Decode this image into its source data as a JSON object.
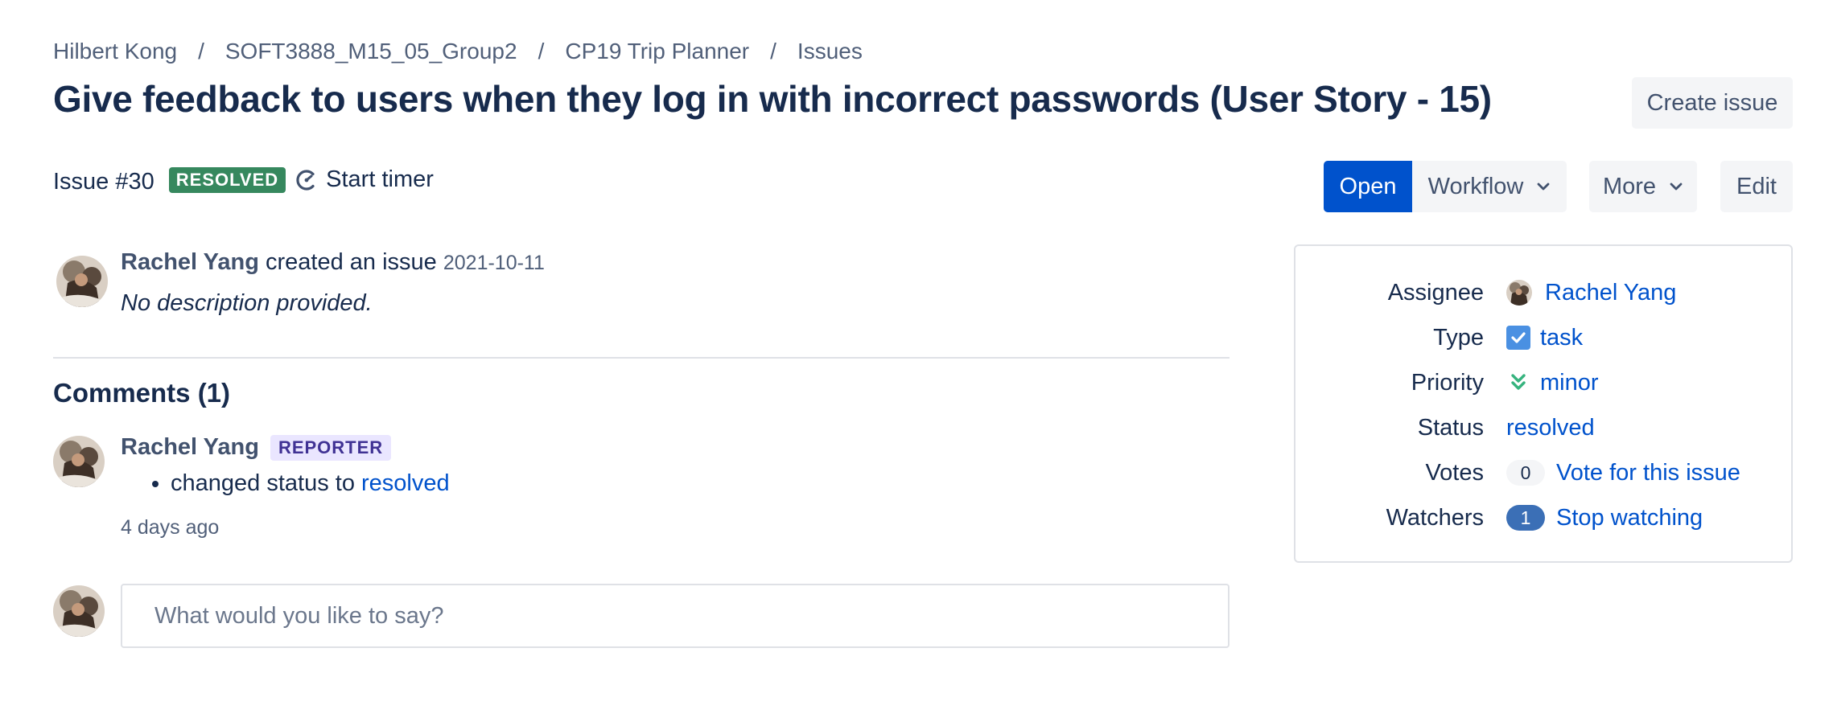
{
  "breadcrumb": [
    "Hilbert Kong",
    "SOFT3888_M15_05_Group2",
    "CP19 Trip Planner",
    "Issues"
  ],
  "breadcrumb_separator": "/",
  "title": "Give feedback to users when they log in with incorrect passwords (User Story - 15)",
  "toolbar": {
    "create": "Create issue",
    "open": "Open",
    "workflow": "Workflow",
    "more": "More",
    "edit": "Edit"
  },
  "issue": {
    "number": "Issue #30",
    "status_badge": "RESOLVED",
    "timer": "Start timer"
  },
  "activity": {
    "author": "Rachel Yang",
    "action": " created an issue ",
    "date": "2021-10-11",
    "description": "No description provided."
  },
  "comments": {
    "heading": "Comments (1)",
    "items": [
      {
        "author": "Rachel Yang",
        "role": "REPORTER",
        "change_prefix": "changed status to ",
        "change_value": "resolved",
        "ago": "4 days ago"
      }
    ]
  },
  "reply": {
    "placeholder": "What would you like to say?"
  },
  "details": {
    "assignee": {
      "label": "Assignee",
      "value": "Rachel Yang"
    },
    "type": {
      "label": "Type",
      "value": "task"
    },
    "priority": {
      "label": "Priority",
      "value": "minor"
    },
    "status": {
      "label": "Status",
      "value": "resolved"
    },
    "votes": {
      "label": "Votes",
      "count": "0",
      "action": "Vote for this issue"
    },
    "watchers": {
      "label": "Watchers",
      "count": "1",
      "action": "Stop watching"
    }
  },
  "colors": {
    "primary": "#0052cc",
    "resolved": "#36885e",
    "reporter_bg": "#eae6ff",
    "reporter_fg": "#403294",
    "priority_minor": "#36b37e"
  },
  "icons": [
    "timer-icon",
    "chevron-down-icon",
    "task-checkbox-icon",
    "priority-minor-icon",
    "avatar"
  ]
}
